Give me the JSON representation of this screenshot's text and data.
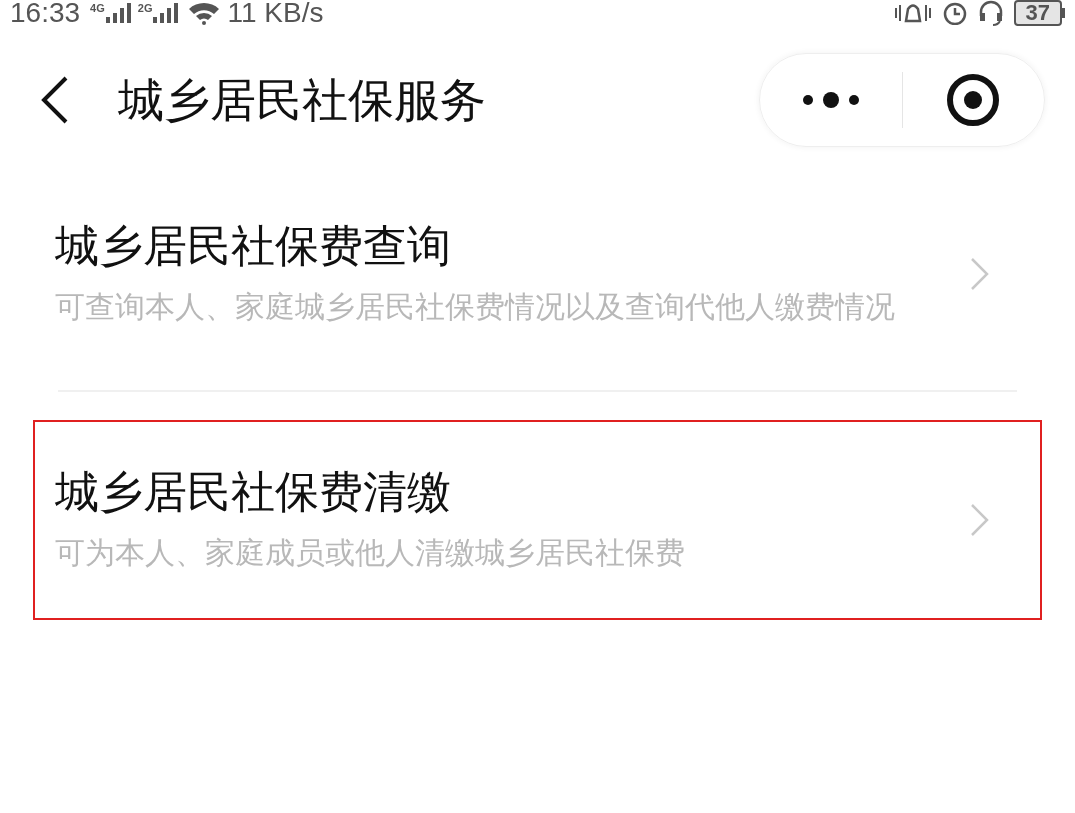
{
  "status_bar": {
    "time": "16:33",
    "signals": [
      "4G",
      "2G"
    ],
    "speed": "11 KB/s",
    "battery": "37"
  },
  "header": {
    "title": "城乡居民社保服务"
  },
  "items": [
    {
      "title": "城乡居民社保费查询",
      "description": "可查询本人、家庭城乡居民社保费情况以及查询代他人缴费情况",
      "highlighted": false
    },
    {
      "title": "城乡居民社保费清缴",
      "description": "可为本人、家庭成员或他人清缴城乡居民社保费",
      "highlighted": true
    }
  ]
}
